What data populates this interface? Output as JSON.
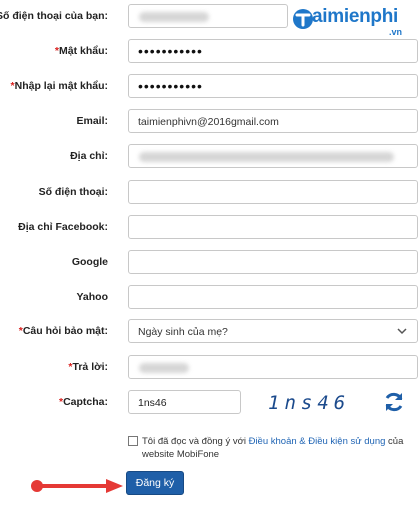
{
  "form": {
    "required_mark": "*",
    "rows": [
      {
        "key": "phone_top",
        "label": "Số điện thoại của bạn:",
        "required": true,
        "value": ""
      },
      {
        "key": "password",
        "label": "Mật khẩu:",
        "required": true,
        "value": "•••••••••••"
      },
      {
        "key": "password_confirm",
        "label": "Nhập lại mật khẩu:",
        "required": true,
        "value": "•••••••••••"
      },
      {
        "key": "email",
        "label": "Email:",
        "required": false,
        "value": "taimienphivn@2016gmail.com"
      },
      {
        "key": "address",
        "label": "Địa chỉ:",
        "required": false,
        "value": ""
      },
      {
        "key": "phone",
        "label": "Số điện thoại:",
        "required": false,
        "value": ""
      },
      {
        "key": "facebook",
        "label": "Địa chỉ Facebook:",
        "required": false,
        "value": ""
      },
      {
        "key": "google",
        "label": "Google",
        "required": false,
        "value": ""
      },
      {
        "key": "yahoo",
        "label": "Yahoo",
        "required": false,
        "value": ""
      },
      {
        "key": "question",
        "label": "Câu hỏi bảo mật:",
        "required": true,
        "value": "Ngày sinh của mẹ?"
      },
      {
        "key": "answer",
        "label": "Trả lời:",
        "required": true,
        "value": ""
      },
      {
        "key": "captcha",
        "label": "Captcha:",
        "required": true,
        "value": "1ns46"
      }
    ],
    "captcha_image_text": "1ns46",
    "agree_text_before": "Tôi đã đọc và đồng ý với ",
    "agree_link": "Điều khoản & Điều kiện sử dụng",
    "agree_text_after": " của website MobiFone",
    "submit_label": "Đăng ký"
  },
  "logo": {
    "text": "aimienphi",
    "suffix": ".vn"
  },
  "colors": {
    "required": "#d9211f",
    "button": "#1f5fa8",
    "link": "#1f64b4",
    "arrow": "#e53935",
    "logo": "#1f77c9"
  },
  "icons": {
    "refresh": "refresh-icon",
    "select": "chevron-down-icon",
    "annotation": "red-arrow"
  }
}
